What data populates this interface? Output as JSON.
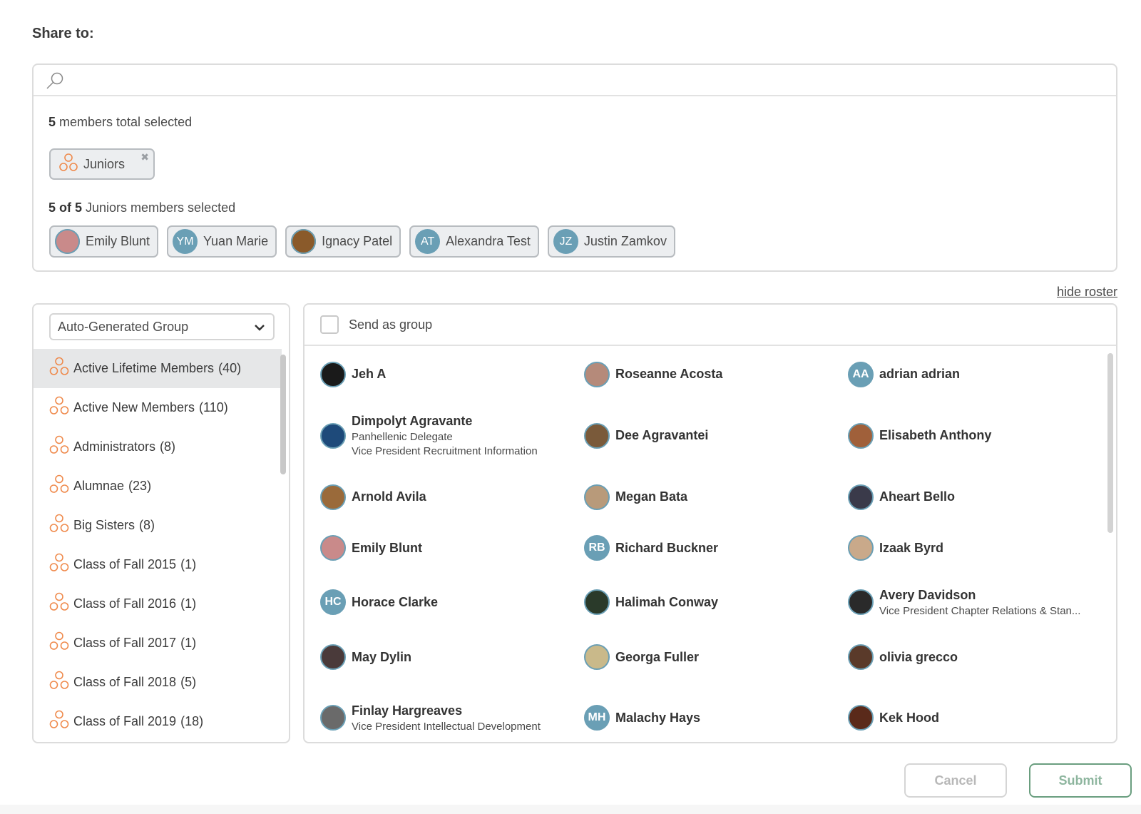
{
  "header": {
    "title": "Share to:"
  },
  "search": {
    "placeholder": ""
  },
  "selection": {
    "total_count": "5",
    "total_suffix": " members total selected",
    "group_chip": "Juniors",
    "group_count": "5 of 5",
    "group_count_suffix": " Juniors members selected",
    "members": [
      {
        "name": "Emily Blunt",
        "initials": "",
        "avatar_color": "#c98a8a"
      },
      {
        "name": "Yuan Marie",
        "initials": "YM",
        "avatar_color": "#6a9fb5"
      },
      {
        "name": "Ignacy Patel",
        "initials": "",
        "avatar_color": "#8a5a2a"
      },
      {
        "name": "Alexandra Test",
        "initials": "AT",
        "avatar_color": "#6a9fb5"
      },
      {
        "name": "Justin Zamkov",
        "initials": "JZ",
        "avatar_color": "#6a9fb5"
      }
    ]
  },
  "roster_toggle": "hide roster",
  "group_select": {
    "value": "Auto-Generated Group"
  },
  "groups": [
    {
      "name": "Active Lifetime Members",
      "count": "(40)"
    },
    {
      "name": "Active New Members",
      "count": "(110)"
    },
    {
      "name": "Administrators",
      "count": "(8)"
    },
    {
      "name": "Alumnae",
      "count": "(23)"
    },
    {
      "name": "Big Sisters",
      "count": "(8)"
    },
    {
      "name": "Class of Fall 2015",
      "count": "(1)"
    },
    {
      "name": "Class of Fall 2016",
      "count": "(1)"
    },
    {
      "name": "Class of Fall 2017",
      "count": "(1)"
    },
    {
      "name": "Class of Fall 2018",
      "count": "(5)"
    },
    {
      "name": "Class of Fall 2019",
      "count": "(18)"
    }
  ],
  "send_as_group": "Send as group",
  "roster": [
    [
      {
        "name": "Jeh A",
        "sub1": "",
        "sub2": "",
        "initials": "",
        "color": "#1a1a1a"
      },
      {
        "name": "Roseanne Acosta",
        "sub1": "",
        "sub2": "",
        "initials": "",
        "color": "#b58a7a"
      },
      {
        "name": "adrian adrian",
        "sub1": "",
        "sub2": "",
        "initials": "AA",
        "color": "#6a9fb5"
      }
    ],
    [
      {
        "name": "Dimpolyt Agravante",
        "sub1": "Panhellenic Delegate",
        "sub2": "Vice President Recruitment Information",
        "initials": "",
        "color": "#1e4a7a"
      },
      {
        "name": "Dee Agravantei",
        "sub1": "",
        "sub2": "",
        "initials": "",
        "color": "#7a5a3a"
      },
      {
        "name": "Elisabeth Anthony",
        "sub1": "",
        "sub2": "",
        "initials": "",
        "color": "#a0603a"
      }
    ],
    [
      {
        "name": "Arnold Avila",
        "sub1": "",
        "sub2": "",
        "initials": "",
        "color": "#9a6a3a"
      },
      {
        "name": "Megan Bata",
        "sub1": "",
        "sub2": "",
        "initials": "",
        "color": "#b89a7a"
      },
      {
        "name": "Aheart Bello",
        "sub1": "",
        "sub2": "",
        "initials": "",
        "color": "#3a3a4a"
      }
    ],
    [
      {
        "name": "Emily Blunt",
        "sub1": "",
        "sub2": "",
        "initials": "",
        "color": "#c98a8a"
      },
      {
        "name": "Richard Buckner",
        "sub1": "",
        "sub2": "",
        "initials": "RB",
        "color": "#6a9fb5"
      },
      {
        "name": "Izaak Byrd",
        "sub1": "",
        "sub2": "",
        "initials": "",
        "color": "#c9a98a"
      }
    ],
    [
      {
        "name": "Horace Clarke",
        "sub1": "",
        "sub2": "",
        "initials": "HC",
        "color": "#6a9fb5"
      },
      {
        "name": "Halimah Conway",
        "sub1": "",
        "sub2": "",
        "initials": "",
        "color": "#2a3a2a"
      },
      {
        "name": "Avery Davidson",
        "sub1": "Vice President Chapter Relations & Stan...",
        "sub2": "",
        "initials": "",
        "color": "#2a2a2a"
      }
    ],
    [
      {
        "name": "May Dylin",
        "sub1": "",
        "sub2": "",
        "initials": "",
        "color": "#4a3a3a"
      },
      {
        "name": "Georga Fuller",
        "sub1": "",
        "sub2": "",
        "initials": "",
        "color": "#c9b98a"
      },
      {
        "name": "olivia grecco",
        "sub1": "",
        "sub2": "",
        "initials": "",
        "color": "#5a3a2a"
      }
    ],
    [
      {
        "name": "Finlay Hargreaves",
        "sub1": "Vice President Intellectual Development",
        "sub2": "",
        "initials": "",
        "color": "#6a6a6a"
      },
      {
        "name": "Malachy Hays",
        "sub1": "",
        "sub2": "",
        "initials": "MH",
        "color": "#6a9fb5"
      },
      {
        "name": "Kek Hood",
        "sub1": "",
        "sub2": "",
        "initials": "",
        "color": "#5a2a1a"
      }
    ]
  ],
  "buttons": {
    "cancel": "Cancel",
    "submit": "Submit"
  },
  "colors": {
    "accent_orange": "#ef8a4c",
    "avatar_blue": "#6a9fb5",
    "submit_green": "#6a9e7f"
  }
}
